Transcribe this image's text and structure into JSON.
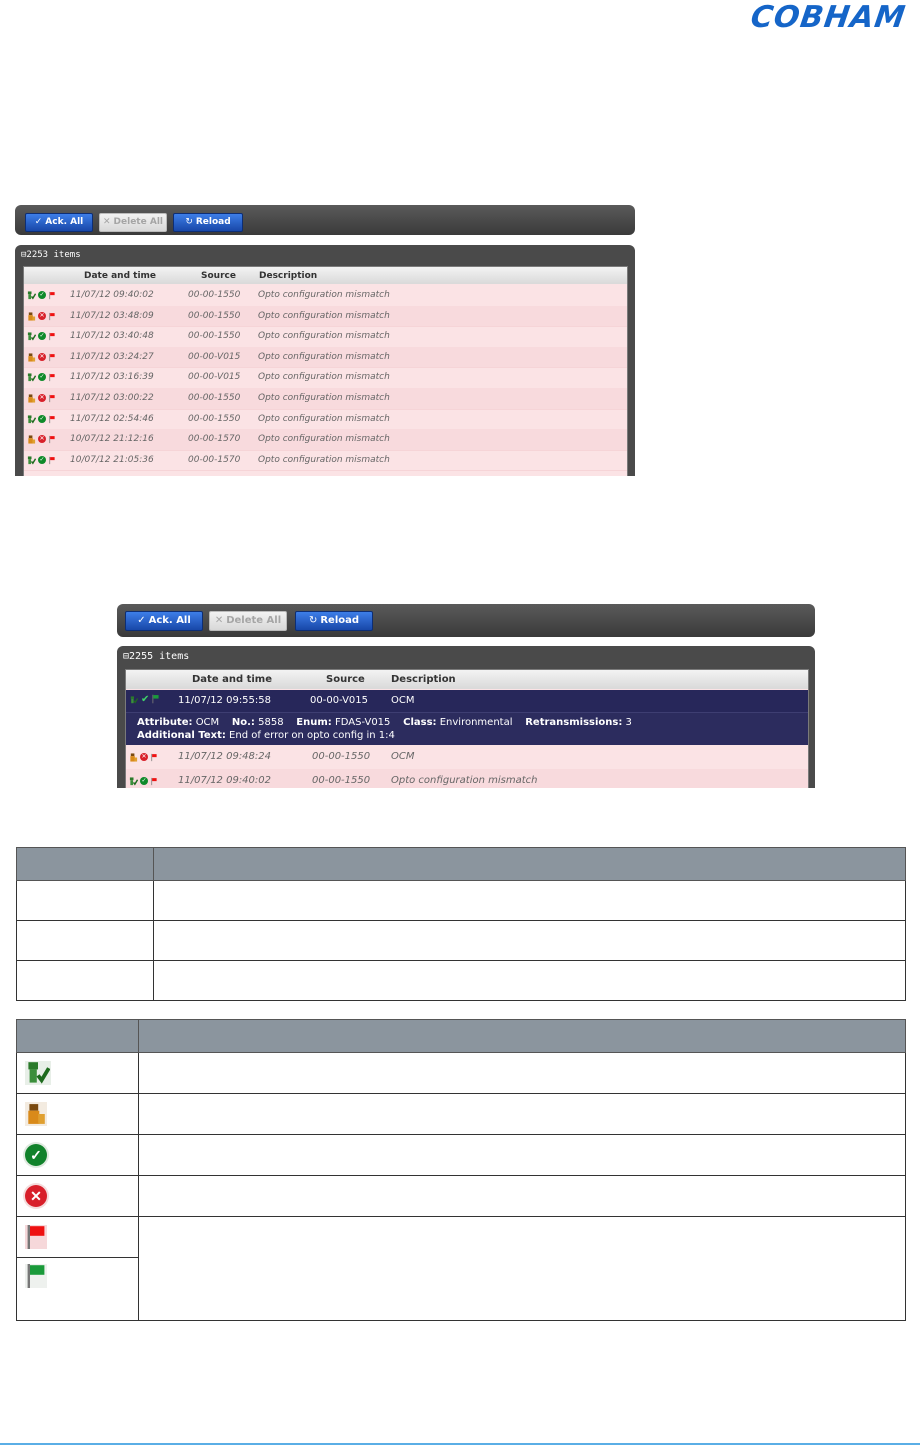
{
  "header": {
    "logo_text": "COBHAM"
  },
  "shot1": {
    "buttons": {
      "ack_all": "Ack. All",
      "delete_all": "Delete All",
      "reload": "Reload"
    },
    "item_count": "2253 items",
    "columns": {
      "date": "Date and time",
      "source": "Source",
      "description": "Description"
    },
    "rows": [
      {
        "ack": true,
        "status": "ok",
        "date": "11/07/12 09:40:02",
        "source": "00-00-1550",
        "description": "Opto configuration mismatch"
      },
      {
        "ack": false,
        "status": "err",
        "date": "11/07/12 03:48:09",
        "source": "00-00-1550",
        "description": "Opto configuration mismatch"
      },
      {
        "ack": true,
        "status": "ok",
        "date": "11/07/12 03:40:48",
        "source": "00-00-1550",
        "description": "Opto configuration mismatch"
      },
      {
        "ack": false,
        "status": "err",
        "date": "11/07/12 03:24:27",
        "source": "00-00-V015",
        "description": "Opto configuration mismatch"
      },
      {
        "ack": true,
        "status": "ok",
        "date": "11/07/12 03:16:39",
        "source": "00-00-V015",
        "description": "Opto configuration mismatch"
      },
      {
        "ack": false,
        "status": "err",
        "date": "11/07/12 03:00:22",
        "source": "00-00-1550",
        "description": "Opto configuration mismatch"
      },
      {
        "ack": true,
        "status": "ok",
        "date": "11/07/12 02:54:46",
        "source": "00-00-1550",
        "description": "Opto configuration mismatch"
      },
      {
        "ack": false,
        "status": "err",
        "date": "10/07/12 21:12:16",
        "source": "00-00-1570",
        "description": "Opto configuration mismatch"
      },
      {
        "ack": true,
        "status": "ok",
        "date": "10/07/12 21:05:36",
        "source": "00-00-1570",
        "description": "Opto configuration mismatch"
      }
    ]
  },
  "shot2": {
    "buttons": {
      "ack_all": "Ack. All",
      "delete_all": "Delete All",
      "reload": "Reload"
    },
    "item_count": "2255 items",
    "columns": {
      "date": "Date and time",
      "source": "Source",
      "description": "Description"
    },
    "selected_row": {
      "date": "11/07/12 09:55:58",
      "source": "00-00-V015",
      "description": "OCM"
    },
    "detail": {
      "attribute_label": "Attribute:",
      "attribute_value": "OCM",
      "no_label": "No.:",
      "no_value": "5858",
      "enum_label": "Enum:",
      "enum_value": "FDAS-V015",
      "class_label": "Class:",
      "class_value": "Environmental",
      "retrans_label": "Retransmissions:",
      "retrans_value": "3",
      "additional_label": "Additional Text:",
      "additional_value": "End of error on opto config in 1:4"
    },
    "rows": [
      {
        "ack": false,
        "status": "err",
        "date": "11/07/12 09:48:24",
        "source": "00-00-1550",
        "description": "OCM"
      },
      {
        "ack": true,
        "status": "ok",
        "date": "11/07/12 09:40:02",
        "source": "00-00-1550",
        "description": "Opto configuration mismatch"
      }
    ]
  },
  "colors": {
    "accent_blue": "#1847a8",
    "row_pink": "#fbe3e5",
    "selected_navy": "#27275a",
    "ok_green": "#0f8a2a",
    "error_red": "#d8202a"
  },
  "icons": [
    "acknowledged-icon",
    "unacknowledged-icon",
    "ok-check-icon",
    "error-x-icon",
    "red-flag-icon",
    "green-flag-icon"
  ]
}
